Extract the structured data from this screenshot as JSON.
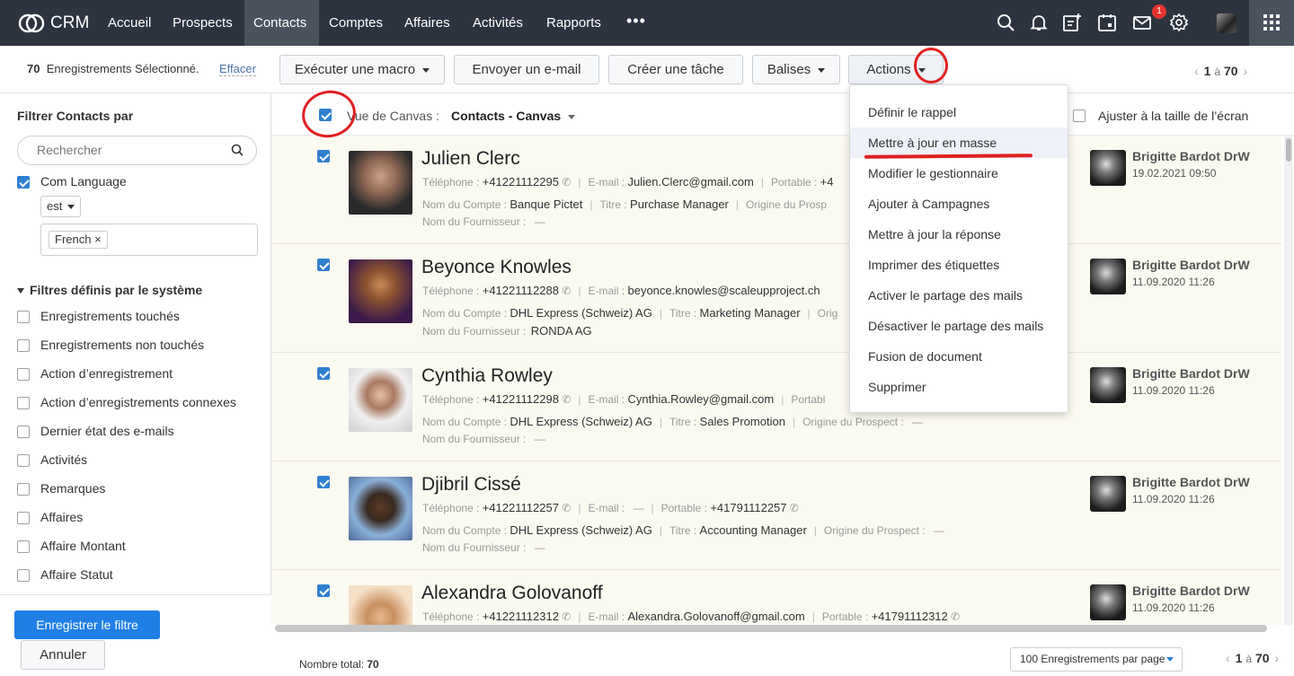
{
  "nav": {
    "logo_text": "CRM",
    "items": [
      "Accueil",
      "Prospects",
      "Contacts",
      "Comptes",
      "Affaires",
      "Activités",
      "Rapports"
    ],
    "more": "•••",
    "mail_badge": "1"
  },
  "toolbar": {
    "selected_count": "70",
    "selected_text": "Enregistrements Sélectionné.",
    "clear": "Effacer",
    "macro": "Exécuter une macro",
    "email": "Envoyer un e-mail",
    "task": "Créer une tâche",
    "tags": "Balises",
    "actions": "Actions",
    "pager_from": "1",
    "pager_sep": "à",
    "pager_to": "70"
  },
  "sidebar": {
    "title": "Filtrer Contacts par",
    "search_placeholder": "Rechercher",
    "filter_field": "Com Language",
    "operator": "est",
    "tag": "French",
    "tag_close": "×",
    "section": "Filtres définis par le système",
    "filters": [
      "Enregistrements touchés",
      "Enregistrements non touchés",
      "Action d’enregistrement",
      "Action d’enregistrements connexes",
      "Dernier état des e-mails",
      "Activités",
      "Remarques",
      "Affaires",
      "Affaire Montant",
      "Affaire Statut"
    ],
    "save": "Enregistrer le filtre",
    "cancel": "Annuler"
  },
  "view": {
    "label": "Vue de Canvas :",
    "value": "Contacts - Canvas",
    "fit": "Ajuster à la taille de l’écran"
  },
  "labels": {
    "phone": "Téléphone :",
    "email": "E-mail :",
    "mobile": "Portable :",
    "account": "Nom du Compte :",
    "title": "Titre :",
    "origin": "Origine du Prospect :",
    "supplier": "Nom du Fournisseur :"
  },
  "records": [
    {
      "name": "Julien Clerc",
      "phone": "+41221112295",
      "email": "Julien.Clerc@gmail.com",
      "mobile": "+4",
      "account": "Banque Pictet",
      "title": "Purchase Manager",
      "origin_label": "Origine du Prosp",
      "origin": "",
      "supplier": "—",
      "owner": "Brigitte Bardot DrW",
      "date": "19.02.2021 09:50"
    },
    {
      "name": "Beyonce Knowles",
      "phone": "+41221112288",
      "email": "beyonce.knowles@scaleupproject.ch",
      "mobile": "",
      "account": "DHL Express (Schweiz) AG",
      "title": "Marketing Manager",
      "origin_label": "Orig",
      "origin": "",
      "supplier": "RONDA AG",
      "owner": "Brigitte Bardot DrW",
      "date": "11.09.2020 11:26"
    },
    {
      "name": "Cynthia Rowley",
      "phone": "+41221112298",
      "email": "Cynthia.Rowley@gmail.com",
      "mobile_label": "Portabl",
      "account": "DHL Express (Schweiz) AG",
      "title": "Sales Promotion",
      "origin_label": "Origine du Prospect :",
      "origin": "—",
      "supplier": "—",
      "owner": "Brigitte Bardot DrW",
      "date": "11.09.2020 11:26"
    },
    {
      "name": "Djibril Cissé",
      "phone": "+41221112257",
      "email": "—",
      "mobile": "+41791112257",
      "account": "DHL Express (Schweiz) AG",
      "title": "Accounting Manager",
      "origin_label": "Origine du Prospect :",
      "origin": "—",
      "supplier": "—",
      "owner": "Brigitte Bardot DrW",
      "date": "11.09.2020 11:26"
    },
    {
      "name": "Alexandra Golovanoff",
      "phone": "+41221112312",
      "email": "Alexandra.Golovanoff@gmail.com",
      "mobile": "+41791112312",
      "owner": "Brigitte Bardot DrW",
      "date": "11.09.2020 11:26"
    }
  ],
  "actions_menu": [
    "Définir le rappel",
    "Mettre à jour en masse",
    "Modifier le gestionnaire",
    "Ajouter à Campagnes",
    "Mettre à jour la réponse",
    "Imprimer des étiquettes",
    "Activer le partage des mails",
    "Désactiver le partage des mails",
    "Fusion de document",
    "Supprimer"
  ],
  "footer": {
    "total_label": "Nombre total:",
    "total": "70",
    "per_page": "100 Enregistrements par page",
    "pager_from": "1",
    "pager_sep": "à",
    "pager_to": "70"
  },
  "colors": {
    "nav_bg": "#2d3440",
    "accent": "#1f7fe5",
    "row_bg": "#fbfaf1",
    "annotation": "#e02020"
  }
}
